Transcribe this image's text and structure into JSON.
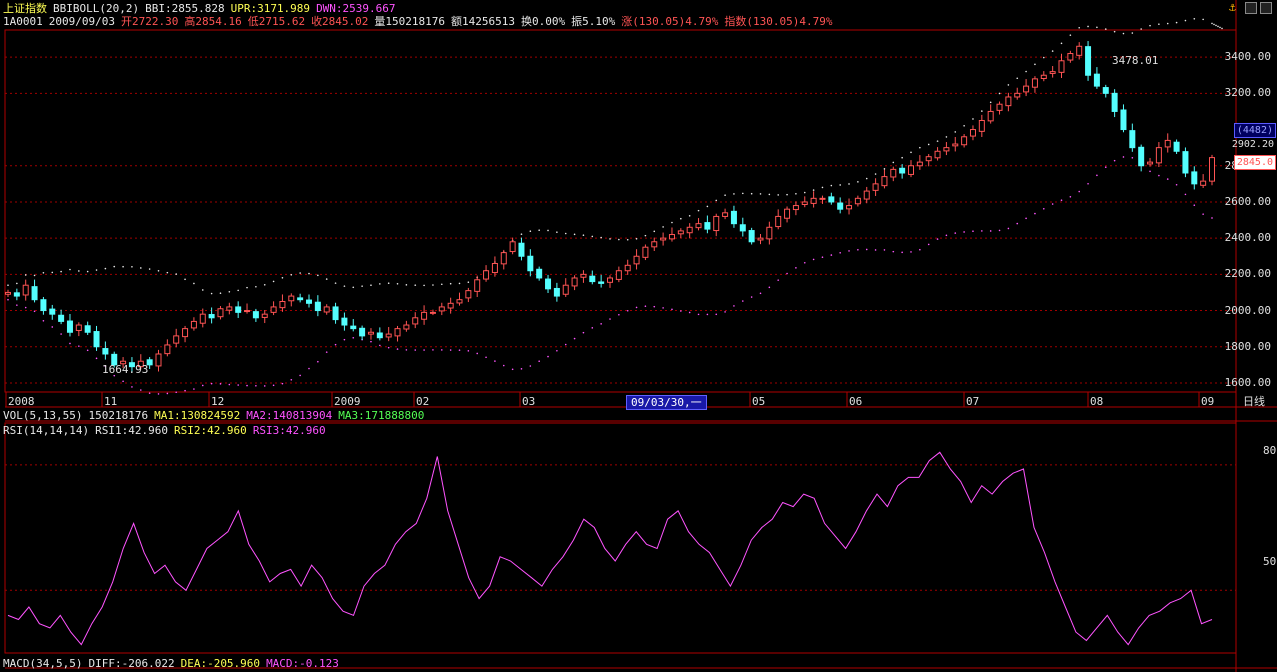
{
  "header": {
    "title": "上证指数",
    "indicator": "BBIBOLL(20,2)",
    "bbi": "BBI:2855.828",
    "upr": "UPR:3171.989",
    "dwn": "DWN:2539.667"
  },
  "infoline": {
    "code": "1A0001",
    "date": "2009/09/03",
    "open": "开2722.30",
    "high": "高2854.16",
    "low": "低2715.62",
    "close": "收2845.02",
    "volume": "量150218176",
    "amount": "额14256513",
    "turnover": "换0.00%",
    "amplitude": "振5.10%",
    "change": "涨(130.05)4.79%",
    "index": "指数(130.05)4.79%"
  },
  "price_axis": {
    "ticks": [
      "3400.00",
      "3200.00",
      "2800.00",
      "2600.00",
      "2400.00",
      "2200.00",
      "2000.00",
      "1800.00",
      "1600.00"
    ],
    "count_tag": "(4482)",
    "cursor_value": "2902.20",
    "last_tag": "2845.0"
  },
  "annotations": {
    "high_label": "3478.01",
    "low_label": "1664.93"
  },
  "date_axis": {
    "labels": [
      "2008",
      "11",
      "12",
      "2009",
      "02",
      "03",
      "05",
      "06",
      "07",
      "08",
      "09"
    ],
    "cursor_label": "09/03/30,一",
    "period_label": "日线"
  },
  "vol_line": {
    "name": "VOL(5,13,55)",
    "vol": "150218176",
    "ma1": "MA1:130824592",
    "ma2": "MA2:140813904",
    "ma3": "MA3:171888800"
  },
  "rsi_line": {
    "name": "RSI(14,14,14)",
    "rsi1": "RSI1:42.960",
    "rsi2": "RSI2:42.960",
    "rsi3": "RSI3:42.960",
    "ticks": [
      "80",
      "50"
    ]
  },
  "macd_line": {
    "name": "MACD(34,5,5)",
    "diff": "DIFF:-206.022",
    "dea": "DEA:-205.960",
    "macd": "MACD:-0.123"
  },
  "colors": {
    "up": "#ff5454",
    "down": "#54ffff",
    "upper_band": "#e8e8e8",
    "lower_band": "#ff54ff",
    "rsi": "#ff54ff",
    "grid": "#a00000",
    "frame": "#b00000"
  },
  "chart_data": [
    {
      "type": "candlestick",
      "title": "上证指数",
      "ylim": [
        1550,
        3550
      ],
      "closes": [
        2100,
        2080,
        2140,
        2060,
        2000,
        1980,
        1940,
        1880,
        1920,
        1880,
        1800,
        1760,
        1700,
        1720,
        1690,
        1720,
        1700,
        1760,
        1810,
        1860,
        1900,
        1940,
        1980,
        1960,
        2010,
        2020,
        1990,
        2000,
        1960,
        1980,
        2020,
        2050,
        2080,
        2060,
        2040,
        2000,
        2020,
        1950,
        1920,
        1900,
        1860,
        1880,
        1850,
        1870,
        1900,
        1920,
        1960,
        1990,
        1990,
        2020,
        2040,
        2060,
        2110,
        2170,
        2220,
        2260,
        2320,
        2380,
        2300,
        2220,
        2180,
        2120,
        2080,
        2140,
        2180,
        2200,
        2160,
        2150,
        2180,
        2220,
        2250,
        2300,
        2350,
        2380,
        2400,
        2420,
        2440,
        2460,
        2480,
        2450,
        2520,
        2540,
        2480,
        2440,
        2380,
        2400,
        2460,
        2520,
        2560,
        2580,
        2600,
        2620,
        2620,
        2600,
        2560,
        2580,
        2620,
        2660,
        2700,
        2740,
        2780,
        2760,
        2800,
        2820,
        2850,
        2880,
        2900,
        2920,
        2960,
        3000,
        3050,
        3100,
        3140,
        3180,
        3200,
        3240,
        3280,
        3300,
        3320,
        3380,
        3420,
        3460,
        3300,
        3240,
        3200,
        3100,
        3000,
        2900,
        2800,
        2820,
        2900,
        2940,
        2880,
        2760,
        2700,
        2715,
        2845
      ],
      "rsi": [
        44,
        43,
        46,
        42,
        41,
        44,
        40,
        37,
        42,
        46,
        52,
        60,
        66,
        59,
        54,
        56,
        52,
        50,
        55,
        60,
        62,
        64,
        69,
        61,
        57,
        52,
        54,
        55,
        51,
        56,
        53,
        48,
        45,
        44,
        51,
        54,
        56,
        61,
        64,
        66,
        72,
        82,
        69,
        61,
        53,
        48,
        51,
        58,
        57,
        55,
        53,
        51,
        55,
        58,
        62,
        67,
        65,
        60,
        57,
        61,
        64,
        61,
        60,
        67,
        69,
        64,
        61,
        59,
        55,
        51,
        56,
        62,
        65,
        67,
        71,
        70,
        73,
        72,
        66,
        63,
        60,
        64,
        69,
        73,
        70,
        75,
        77,
        77,
        81,
        83,
        79,
        76,
        71,
        75,
        73,
        76,
        78,
        79,
        65,
        59,
        52,
        46,
        40,
        38,
        41,
        44,
        40,
        37,
        41,
        44,
        45,
        47,
        48,
        50,
        42,
        43
      ]
    },
    {
      "type": "line",
      "name": "RSI",
      "ylim": [
        35,
        90
      ],
      "ticks": [
        80,
        50
      ]
    }
  ]
}
